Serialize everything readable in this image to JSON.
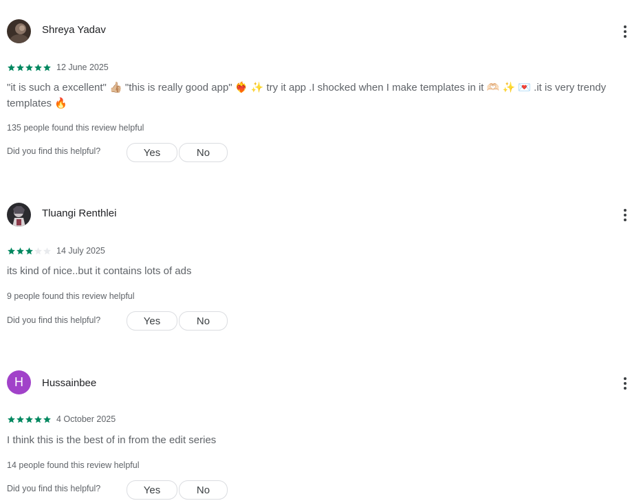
{
  "colors": {
    "star_filled": "#01875f",
    "star_empty": "#e8eaed",
    "avatar_h": "#a142c9",
    "text_secondary": "#5f6368"
  },
  "icons": {
    "star": "star-icon",
    "more": "more-vert-icon"
  },
  "reviews": [
    {
      "name": "Shreya Yadav",
      "avatar_type": "photo",
      "rating": 5,
      "date": "12 June 2025",
      "text": "\"it is such a excellent\" 👍🏼 \"this is really good app\" ❤️‍🔥 ✨ try it app .I shocked when I make templates in it 🫶🏻 ✨ 💌 .it is very trendy templates 🔥",
      "helpful_count": "135 people found this review helpful",
      "helpful_question": "Did you find this helpful?",
      "yes_label": "Yes",
      "no_label": "No"
    },
    {
      "name": "Tluangi Renthlei",
      "avatar_type": "photo",
      "rating": 3,
      "date": "14 July 2025",
      "text": "its kind of nice..but it contains lots of ads",
      "helpful_count": "9 people found this review helpful",
      "helpful_question": "Did you find this helpful?",
      "yes_label": "Yes",
      "no_label": "No"
    },
    {
      "name": "Hussainbee",
      "avatar_type": "letter",
      "avatar_letter": "H",
      "rating": 5,
      "date": "4 October 2025",
      "text": "I think this is the best of in from the edit series",
      "helpful_count": "14 people found this review helpful",
      "helpful_question": "Did you find this helpful?",
      "yes_label": "Yes",
      "no_label": "No"
    }
  ]
}
